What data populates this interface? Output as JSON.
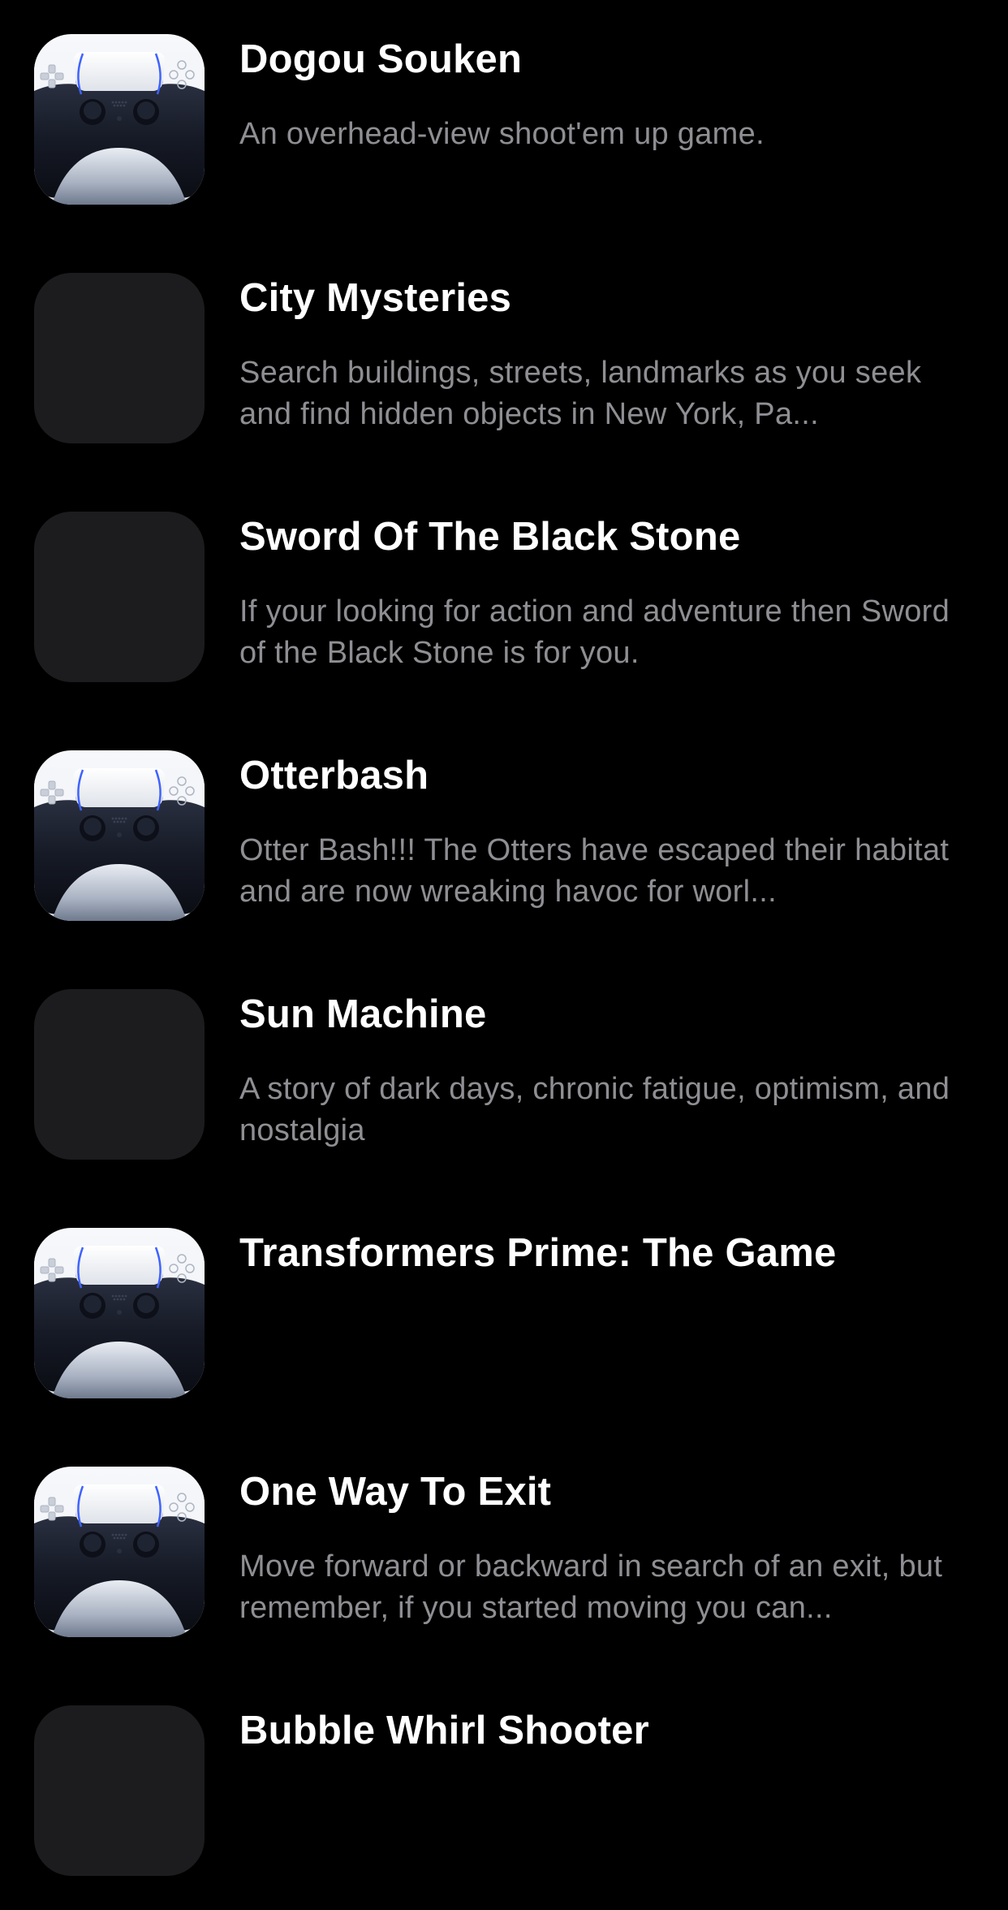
{
  "colors": {
    "background": "#000000",
    "title": "#ffffff",
    "description": "#8e8e93",
    "placeholder_tile": "#1c1c1e"
  },
  "games": [
    {
      "title": "Dogou Souken",
      "description": "An overhead-view shoot'em up game.",
      "icon": "gamepad-icon"
    },
    {
      "title": "City Mysteries",
      "description": "Search buildings, streets, landmarks as you seek and find hidden objects in New York, Pa...",
      "icon": "placeholder-icon"
    },
    {
      "title": "Sword Of The Black Stone",
      "description": "If your looking for action and adventure then Sword of the Black Stone is for you.",
      "icon": "placeholder-icon"
    },
    {
      "title": "Otterbash",
      "description": "Otter Bash!!! The Otters have escaped their habitat and are now wreaking havoc for worl...",
      "icon": "gamepad-icon"
    },
    {
      "title": "Sun Machine",
      "description": "A story of dark days, chronic fatigue, optimism, and nostalgia",
      "icon": "placeholder-icon"
    },
    {
      "title": "Transformers Prime: The Game",
      "description": "",
      "icon": "gamepad-icon"
    },
    {
      "title": "One Way To Exit",
      "description": "Move forward or backward in search of an exit, but remember, if you started moving you can...",
      "icon": "gamepad-icon"
    },
    {
      "title": "Bubble Whirl Shooter",
      "description": "",
      "icon": "placeholder-icon"
    }
  ]
}
